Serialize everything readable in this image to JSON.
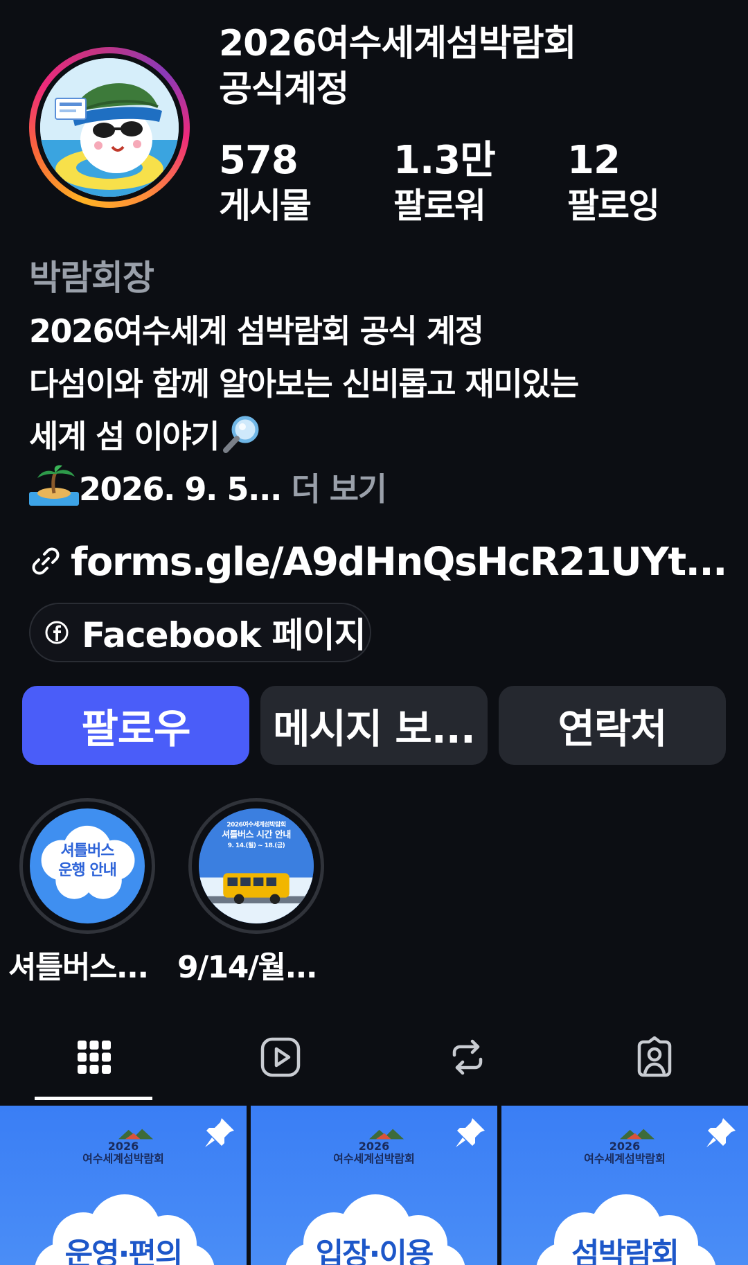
{
  "profile": {
    "name_line1": "2026여수세계섬박람회",
    "name_line2": "공식계정",
    "stats": {
      "posts": {
        "value": "578",
        "label": "게시물"
      },
      "followers": {
        "value": "1.3만",
        "label": "팔로워"
      },
      "following": {
        "value": "12",
        "label": "팔로잉"
      }
    },
    "category": "박람회장",
    "bio": {
      "line1": "2026여수세계 섬박람회 공식 계정",
      "line2": "다섬이와 함께 알아보는 신비롭고 재미있는",
      "line3": "세계 섬 이야기",
      "line4_text": "2026. 9. 5...",
      "more_label": "더 보기"
    },
    "link": "forms.gle/A9dHnQsHcR21UYt...",
    "facebook_label": "Facebook 페이지"
  },
  "actions": {
    "follow": "팔로우",
    "message": "메시지 보...",
    "contact": "연락처"
  },
  "highlights": [
    {
      "label": "셔틀버스...",
      "cover_text_line1": "셔틀버스",
      "cover_text_line2": "운행 안내"
    },
    {
      "label": "9/14/월...",
      "cover_text_line1": "2026여수세계섬박람회",
      "cover_text_line2": "셔틀버스 시간 안내",
      "cover_text_line3": "9. 14.(월) ~ 18.(금)"
    }
  ],
  "tabs": [
    {
      "name": "grid",
      "icon": "grid-icon",
      "active": true
    },
    {
      "name": "reels",
      "icon": "reels-play-icon",
      "active": false
    },
    {
      "name": "reposts",
      "icon": "repost-icon",
      "active": false
    },
    {
      "name": "tagged",
      "icon": "tagged-person-icon",
      "active": false
    }
  ],
  "posts": [
    {
      "expo_year": "2026",
      "expo_name": "여수세계섬박람회",
      "title": "운영·편의",
      "pinned": true
    },
    {
      "expo_year": "2026",
      "expo_name": "여수세계섬박람회",
      "title": "입장·이용",
      "pinned": true
    },
    {
      "expo_year": "2026",
      "expo_name": "여수세계섬박람회",
      "title": "섬박람회",
      "pinned": true
    }
  ],
  "colors": {
    "background": "#0c0e13",
    "follow_button": "#4a5df9",
    "secondary_button": "#25282f",
    "muted_text": "#9aa0aa",
    "post_blue": "#3a7ef5"
  }
}
